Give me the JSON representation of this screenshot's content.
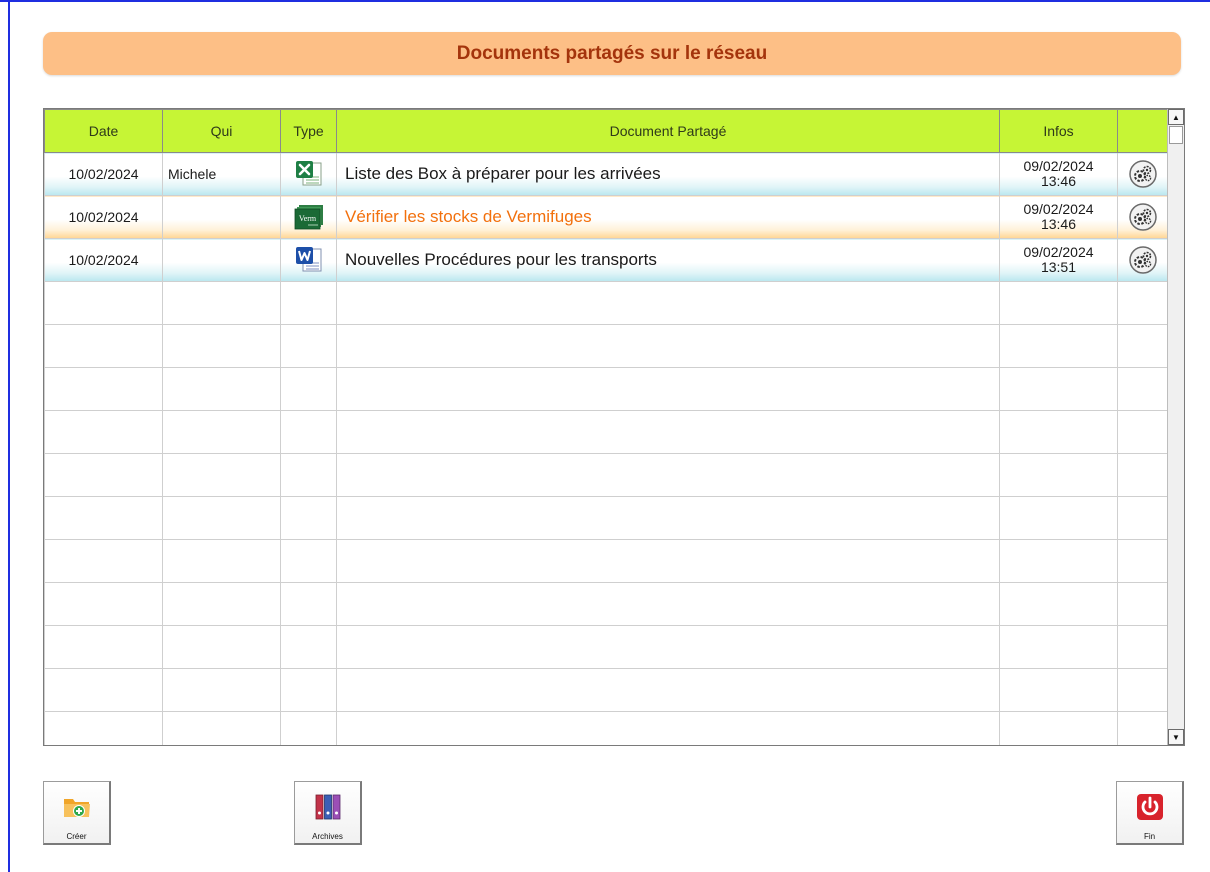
{
  "header": {
    "title": "Documents partagés sur le réseau"
  },
  "table": {
    "columns": [
      "Date",
      "Qui",
      "Type",
      "Document Partagé",
      "Infos",
      ""
    ],
    "rows": [
      {
        "date": "10/02/2024",
        "qui": "Michele",
        "type_icon": "excel-file-icon",
        "document": "Liste des Box à préparer pour les arrivées",
        "info_date": "09/02/2024",
        "info_time": "13:46",
        "style": "blue"
      },
      {
        "date": "10/02/2024",
        "qui": "",
        "type_icon": "verm-file-icon",
        "document": "Vérifier les stocks de Vermifuges",
        "info_date": "09/02/2024",
        "info_time": "13:46",
        "style": "orange"
      },
      {
        "date": "10/02/2024",
        "qui": "",
        "type_icon": "word-file-icon",
        "document": "Nouvelles Procédures pour les transports",
        "info_date": "09/02/2024",
        "info_time": "13:51",
        "style": "blue"
      }
    ],
    "verm_icon_text": "Verm"
  },
  "scrollbar": {
    "up_arrow": "▲",
    "down_arrow": "▼"
  },
  "toolbar": {
    "create_label": "Créer",
    "archives_label": "Archives",
    "fin_label": "Fin"
  },
  "colors": {
    "title_bg": "#fdbf86",
    "title_text": "#a4340c",
    "header_bg": "#c6f535",
    "accent_orange": "#f2700d",
    "frame_blue": "#1f2ee0"
  }
}
